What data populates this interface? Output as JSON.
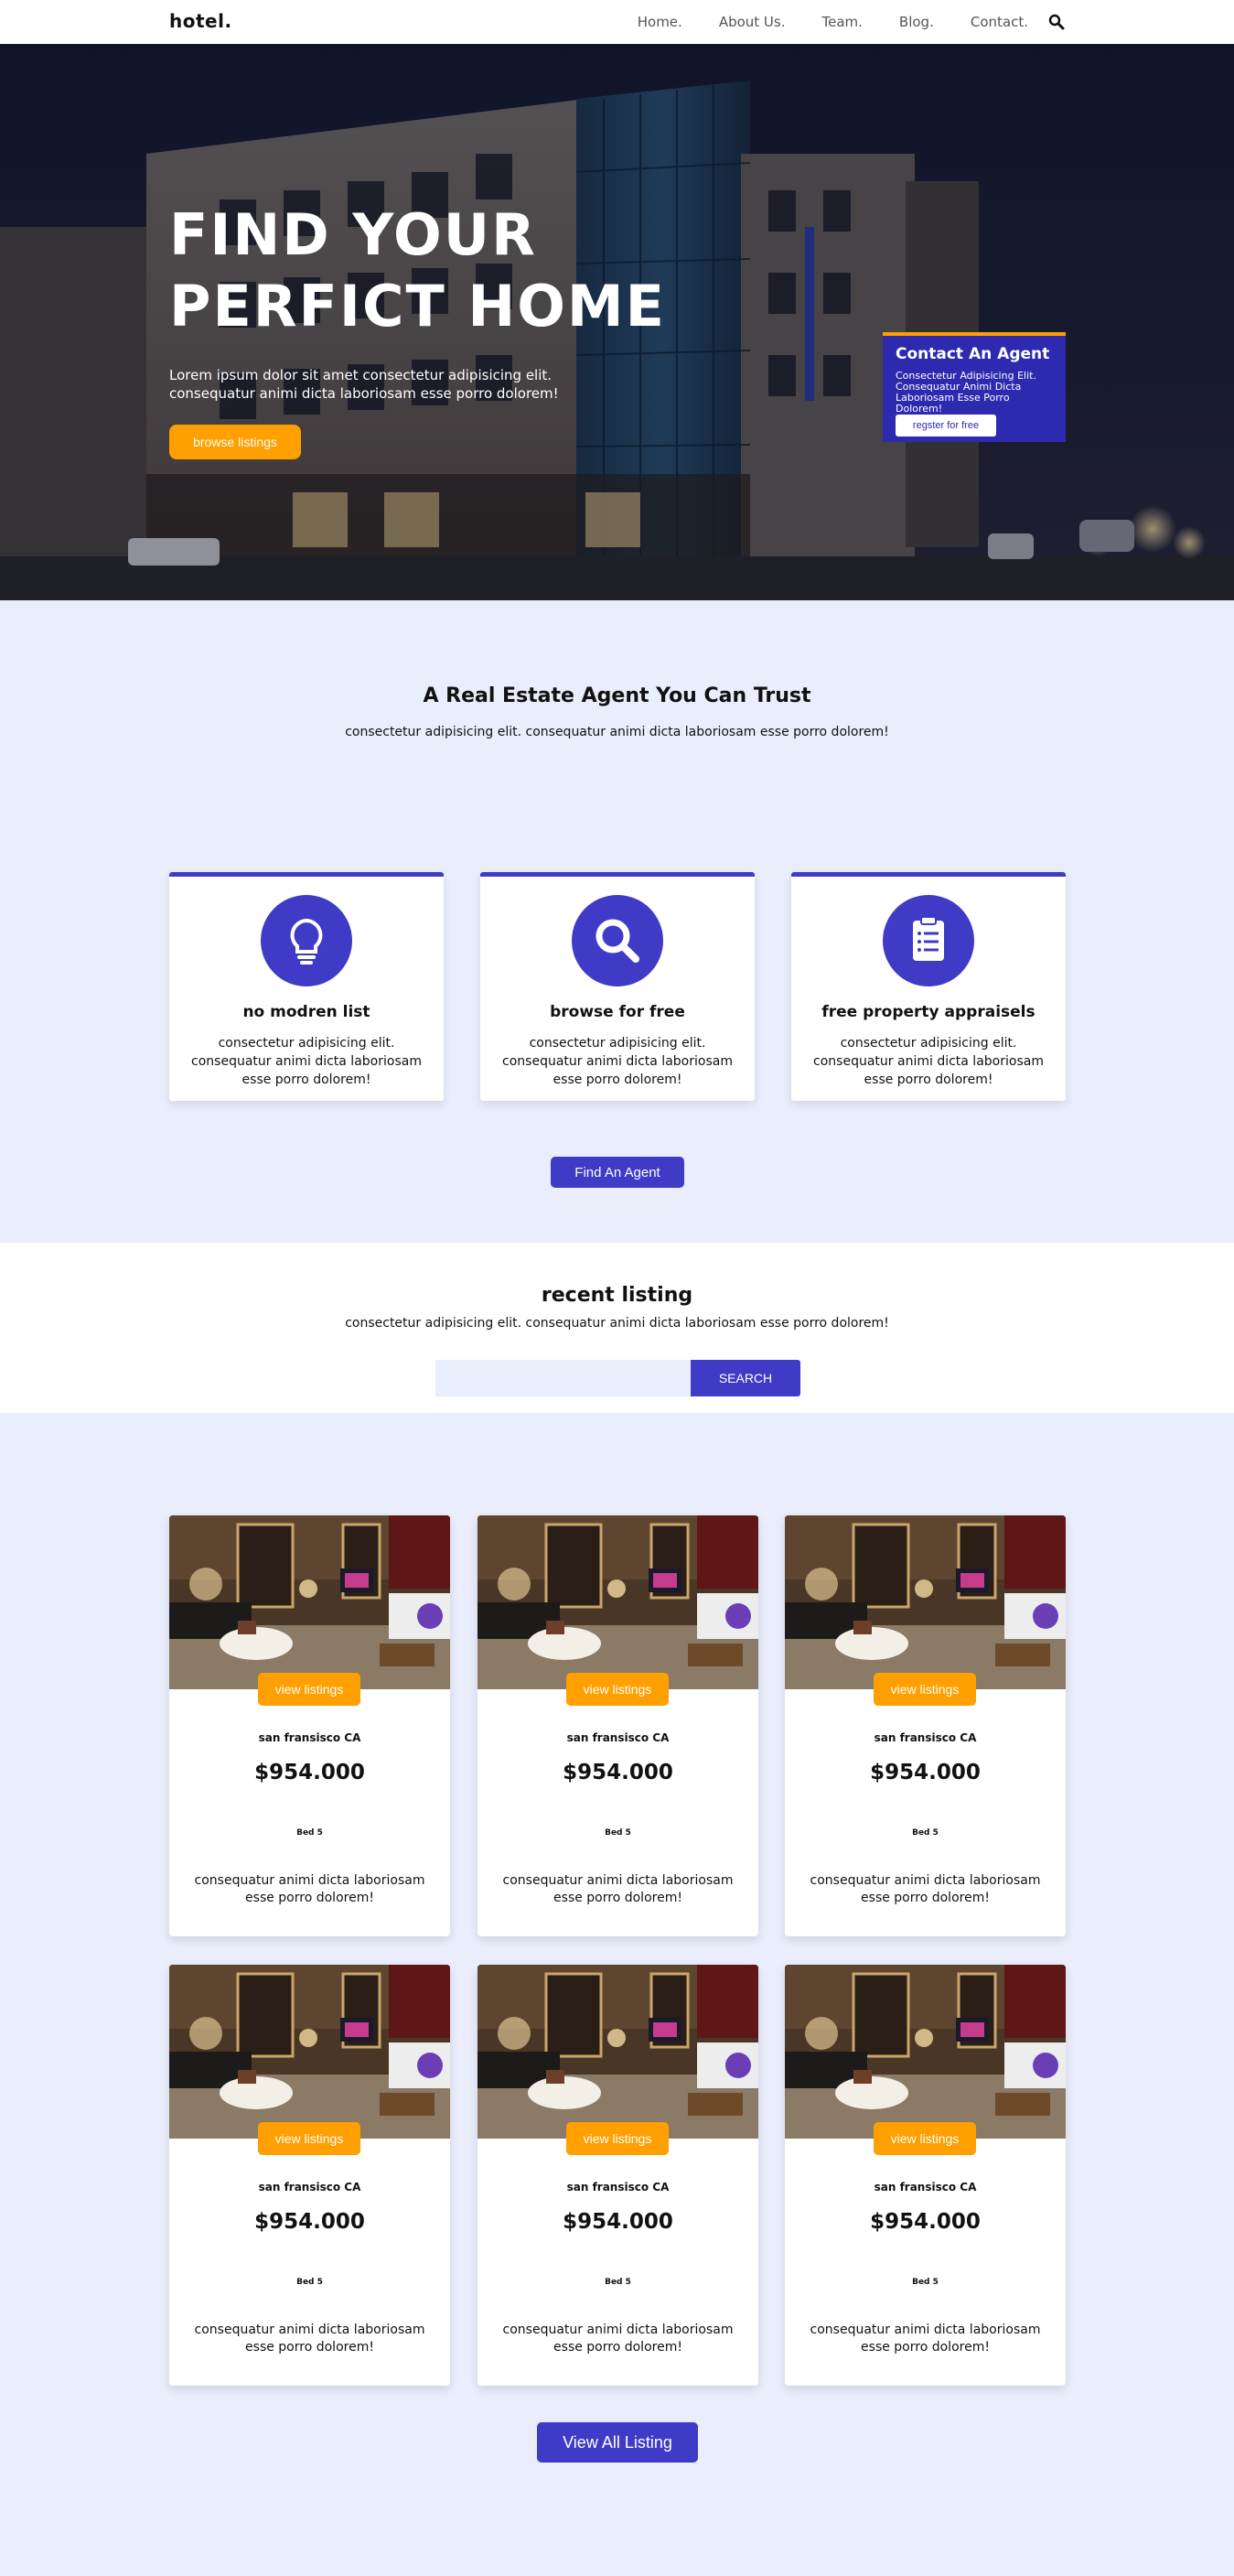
{
  "nav": {
    "logo": "hotel.",
    "links": [
      "Home.",
      "About Us.",
      "Team.",
      "Blog.",
      "Contact."
    ],
    "search_icon": "search-icon"
  },
  "hero": {
    "title_line1": "FIND YOUR",
    "title_line2": "PERFICT HOME",
    "lead": "Lorem ipsum dolor sit amet consectetur adipisicing elit. consequatur animi dicta laboriosam esse porro dolorem!",
    "browse_label": "browse listings"
  },
  "agent": {
    "title": "Contact An Agent",
    "desc": "Consectetur Adipisicing Elit. Consequatur Animi Dicta Laboriosam Esse Porro Dolorem!",
    "button": "regster for free"
  },
  "trust": {
    "title": "A Real Estate Agent You Can Trust",
    "subtitle": "consectetur adipisicing elit. consequatur animi dicta laboriosam esse porro dolorem!",
    "features": [
      {
        "icon": "lightbulb-icon",
        "title": "no modren list",
        "desc": "consectetur adipisicing elit. consequatur animi dicta laboriosam esse porro dolorem!"
      },
      {
        "icon": "search-icon",
        "title": "browse for free",
        "desc": "consectetur adipisicing elit. consequatur animi dicta laboriosam esse porro dolorem!"
      },
      {
        "icon": "clipboard-icon",
        "title": "free property appraisels",
        "desc": "consectetur adipisicing elit. consequatur animi dicta laboriosam esse porro dolorem!"
      }
    ],
    "button": "Find An Agent"
  },
  "recent": {
    "title": "recent listing",
    "subtitle": "consectetur adipisicing elit. consequatur animi dicta laboriosam esse porro dolorem!",
    "search_placeholder": "",
    "search_button": "SEARCH"
  },
  "listings": [
    {
      "button": "view listings",
      "location": "san fransisco CA",
      "price": "$954.000",
      "bed": "Bed 5",
      "desc": "consequatur animi dicta laboriosam esse porro dolorem!"
    },
    {
      "button": "view listings",
      "location": "san fransisco CA",
      "price": "$954.000",
      "bed": "Bed 5",
      "desc": "consequatur animi dicta laboriosam esse porro dolorem!"
    },
    {
      "button": "view listings",
      "location": "san fransisco CA",
      "price": "$954.000",
      "bed": "Bed 5",
      "desc": "consequatur animi dicta laboriosam esse porro dolorem!"
    },
    {
      "button": "view listings",
      "location": "san fransisco CA",
      "price": "$954.000",
      "bed": "Bed 5",
      "desc": "consequatur animi dicta laboriosam esse porro dolorem!"
    },
    {
      "button": "view listings",
      "location": "san fransisco CA",
      "price": "$954.000",
      "bed": "Bed 5",
      "desc": "consequatur animi dicta laboriosam esse porro dolorem!"
    },
    {
      "button": "view listings",
      "location": "san fransisco CA",
      "price": "$954.000",
      "bed": "Bed 5",
      "desc": "consequatur animi dicta laboriosam esse porro dolorem!"
    }
  ],
  "view_all": "View All Listing",
  "colors": {
    "accent": "#3f3bc7",
    "orange": "#ff9f00",
    "background": "#eaedfb"
  }
}
